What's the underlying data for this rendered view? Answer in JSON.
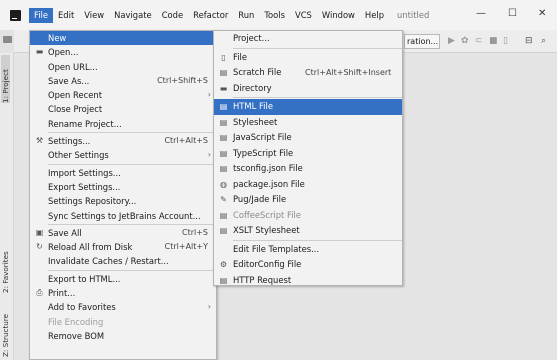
{
  "window": {
    "title": "untitled",
    "minimize": "—",
    "maximize": "☐",
    "close": "✕"
  },
  "menubar": [
    "File",
    "Edit",
    "View",
    "Navigate",
    "Code",
    "Refactor",
    "Run",
    "Tools",
    "VCS",
    "Window",
    "Help"
  ],
  "toolbar": {
    "config_label": "ration..."
  },
  "side_tabs": {
    "project": "1: Project",
    "favorites": "2: Favorites",
    "structure": "Z: Structure"
  },
  "file_menu": [
    {
      "label": "New",
      "icon": "",
      "shortcut": "",
      "arrow": "",
      "highlighted": true
    },
    {
      "label": "Open...",
      "icon": "folder-icon",
      "shortcut": ""
    },
    {
      "label": "Open URL...",
      "shortcut": ""
    },
    {
      "label": "Save As...",
      "shortcut": "Ctrl+Shift+S"
    },
    {
      "label": "Open Recent",
      "shortcut": "",
      "arrow": "›"
    },
    {
      "label": "Close Project",
      "shortcut": ""
    },
    {
      "label": "Rename Project...",
      "shortcut": ""
    },
    {
      "sep": true
    },
    {
      "label": "Settings...",
      "icon": "wrench-icon",
      "shortcut": "Ctrl+Alt+S"
    },
    {
      "label": "Other Settings",
      "shortcut": "",
      "arrow": "›"
    },
    {
      "sep": true
    },
    {
      "label": "Import Settings...",
      "shortcut": ""
    },
    {
      "label": "Export Settings...",
      "shortcut": ""
    },
    {
      "label": "Settings Repository...",
      "shortcut": ""
    },
    {
      "label": "Sync Settings to JetBrains Account...",
      "shortcut": ""
    },
    {
      "sep": true
    },
    {
      "label": "Save All",
      "icon": "save-icon",
      "shortcut": "Ctrl+S"
    },
    {
      "label": "Reload All from Disk",
      "icon": "reload-icon",
      "shortcut": "Ctrl+Alt+Y"
    },
    {
      "label": "Invalidate Caches / Restart...",
      "shortcut": ""
    },
    {
      "sep": true
    },
    {
      "label": "Export to HTML...",
      "shortcut": ""
    },
    {
      "label": "Print...",
      "icon": "print-icon",
      "shortcut": ""
    },
    {
      "label": "Add to Favorites",
      "shortcut": "",
      "arrow": "›"
    },
    {
      "label": "File Encoding",
      "shortcut": "",
      "disabled": true
    },
    {
      "label": "Remove BOM",
      "shortcut": ""
    }
  ],
  "new_menu": [
    {
      "label": "Project...",
      "icon": ""
    },
    {
      "sep": true
    },
    {
      "label": "File",
      "icon": "file-icon"
    },
    {
      "label": "Scratch File",
      "icon": "scratch-icon",
      "shortcut": "Ctrl+Alt+Shift+Insert"
    },
    {
      "label": "Directory",
      "icon": "directory-icon"
    },
    {
      "sep": true
    },
    {
      "label": "HTML File",
      "icon": "html-icon",
      "highlighted": true
    },
    {
      "label": "Stylesheet",
      "icon": "css-icon"
    },
    {
      "label": "JavaScript File",
      "icon": "js-icon"
    },
    {
      "label": "TypeScript File",
      "icon": "ts-icon"
    },
    {
      "label": "tsconfig.json File",
      "icon": "tsconfig-icon"
    },
    {
      "label": "package.json File",
      "icon": "package-icon"
    },
    {
      "label": "Pug/Jade File",
      "icon": "pug-icon"
    },
    {
      "label": "CoffeeScript File",
      "icon": "coffee-icon",
      "faded": true
    },
    {
      "label": "XSLT Stylesheet",
      "icon": "xslt-icon"
    },
    {
      "sep": true
    },
    {
      "label": "Edit File Templates...",
      "icon": ""
    },
    {
      "label": "EditorConfig File",
      "icon": "gear-icon"
    },
    {
      "label": "HTTP Request",
      "icon": "http-icon"
    }
  ],
  "colors": {
    "highlight": "#3470c4",
    "menu_bg": "#f2f2f2"
  }
}
